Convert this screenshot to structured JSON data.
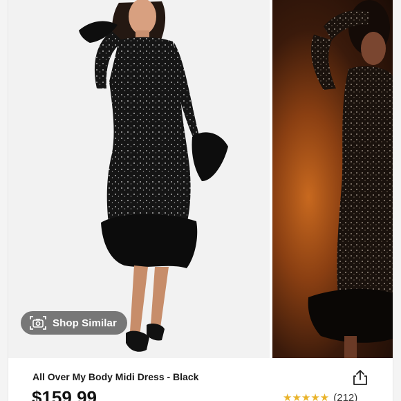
{
  "gallery": {
    "shop_similar_label": "Shop Similar"
  },
  "product": {
    "title": "All Over My Body Midi Dress - Black",
    "price": "$159.99",
    "rating": {
      "value": 5,
      "stars_display": "★★★★★",
      "count_label": "(212)"
    }
  },
  "colors": {
    "badge_red": "#cf2b26",
    "star_gold": "#e9b32a",
    "overlay_gray": "#5c5c5c"
  }
}
